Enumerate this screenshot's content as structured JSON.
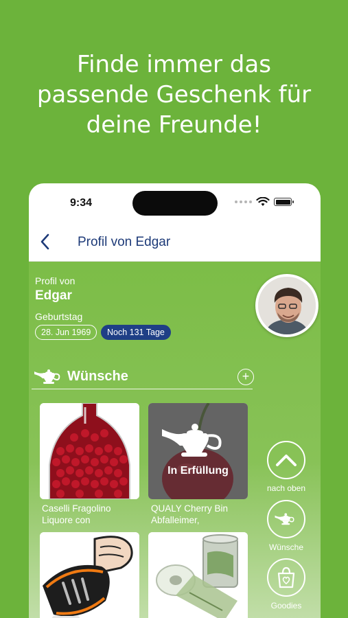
{
  "headline": {
    "line1": "Finde immer das",
    "line2": "passende Geschenk für",
    "line3": "deine Freunde!"
  },
  "status_bar": {
    "time": "9:34",
    "icons": [
      "signal-dots-icon",
      "wifi-icon",
      "battery-icon"
    ]
  },
  "nav": {
    "back_icon": "chevron-left-icon",
    "title": "Profil von Edgar"
  },
  "profile": {
    "label": "Profil von",
    "name": "Edgar",
    "birthday_label": "Geburtstag",
    "birthday_date": "28. Jun 1969",
    "days_until": "Noch 131 Tage"
  },
  "wishes": {
    "title": "Wünsche",
    "add_label": "+",
    "items": [
      {
        "caption_line1": "Caselli Fragolino",
        "caption_line2": "Liquore con",
        "status": ""
      },
      {
        "caption_line1": "QUALY Cherry Bin",
        "caption_line2": "Abfalleimer,",
        "status": "In Erfüllung"
      },
      {
        "caption_line1": "",
        "caption_line2": "",
        "status": ""
      },
      {
        "caption_line1": "",
        "caption_line2": "",
        "status": ""
      }
    ]
  },
  "side_actions": [
    {
      "label": "nach oben",
      "icon": "chevron-up-icon"
    },
    {
      "label": "Wünsche",
      "icon": "magic-lamp-icon"
    },
    {
      "label": "Goodies",
      "icon": "gift-bag-icon"
    }
  ],
  "colors": {
    "background": "#6cb33b",
    "nav_text": "#1d3a78",
    "badge": "#1f3f86"
  }
}
